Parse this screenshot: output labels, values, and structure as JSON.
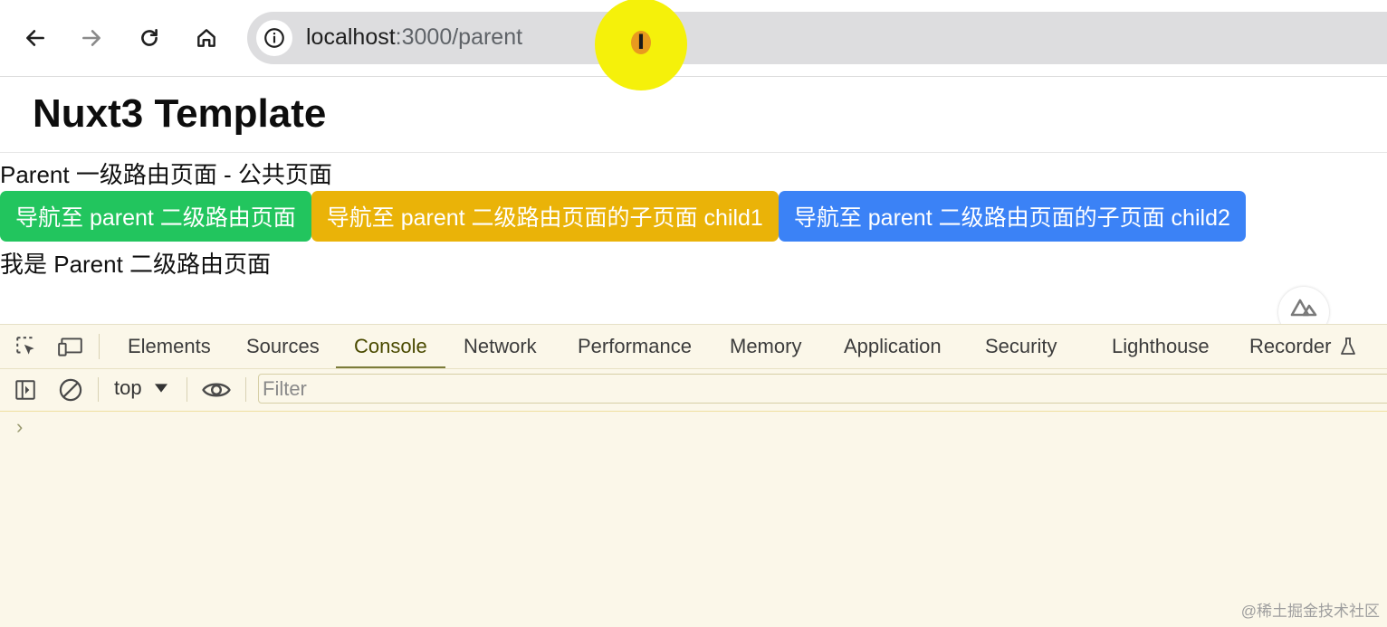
{
  "browser": {
    "url_host": "localhost",
    "url_path": ":3000/parent",
    "icons": [
      "back-arrow-icon",
      "forward-arrow-icon",
      "reload-icon",
      "home-icon",
      "site-info-icon"
    ]
  },
  "page": {
    "title": "Nuxt3 Template",
    "intro": "Parent 一级路由页面 - 公共页面",
    "buttons": [
      {
        "label": "导航至 parent 二级路由页面",
        "color": "#22c55e"
      },
      {
        "label": "导航至 parent 二级路由页面的子页面 child1",
        "color": "#eab308"
      },
      {
        "label": "导航至 parent 二级路由页面的子页面 child2",
        "color": "#3b82f6"
      }
    ],
    "child_text": "我是 Parent 二级路由页面"
  },
  "devtools": {
    "tabs": [
      "Elements",
      "Sources",
      "Console",
      "Network",
      "Performance",
      "Memory",
      "Application",
      "Security",
      "Lighthouse",
      "Recorder"
    ],
    "active_tab": "Console",
    "context": "top",
    "filter_placeholder": "Filter",
    "prompt": "›"
  },
  "watermark": "@稀土掘金技术社区"
}
